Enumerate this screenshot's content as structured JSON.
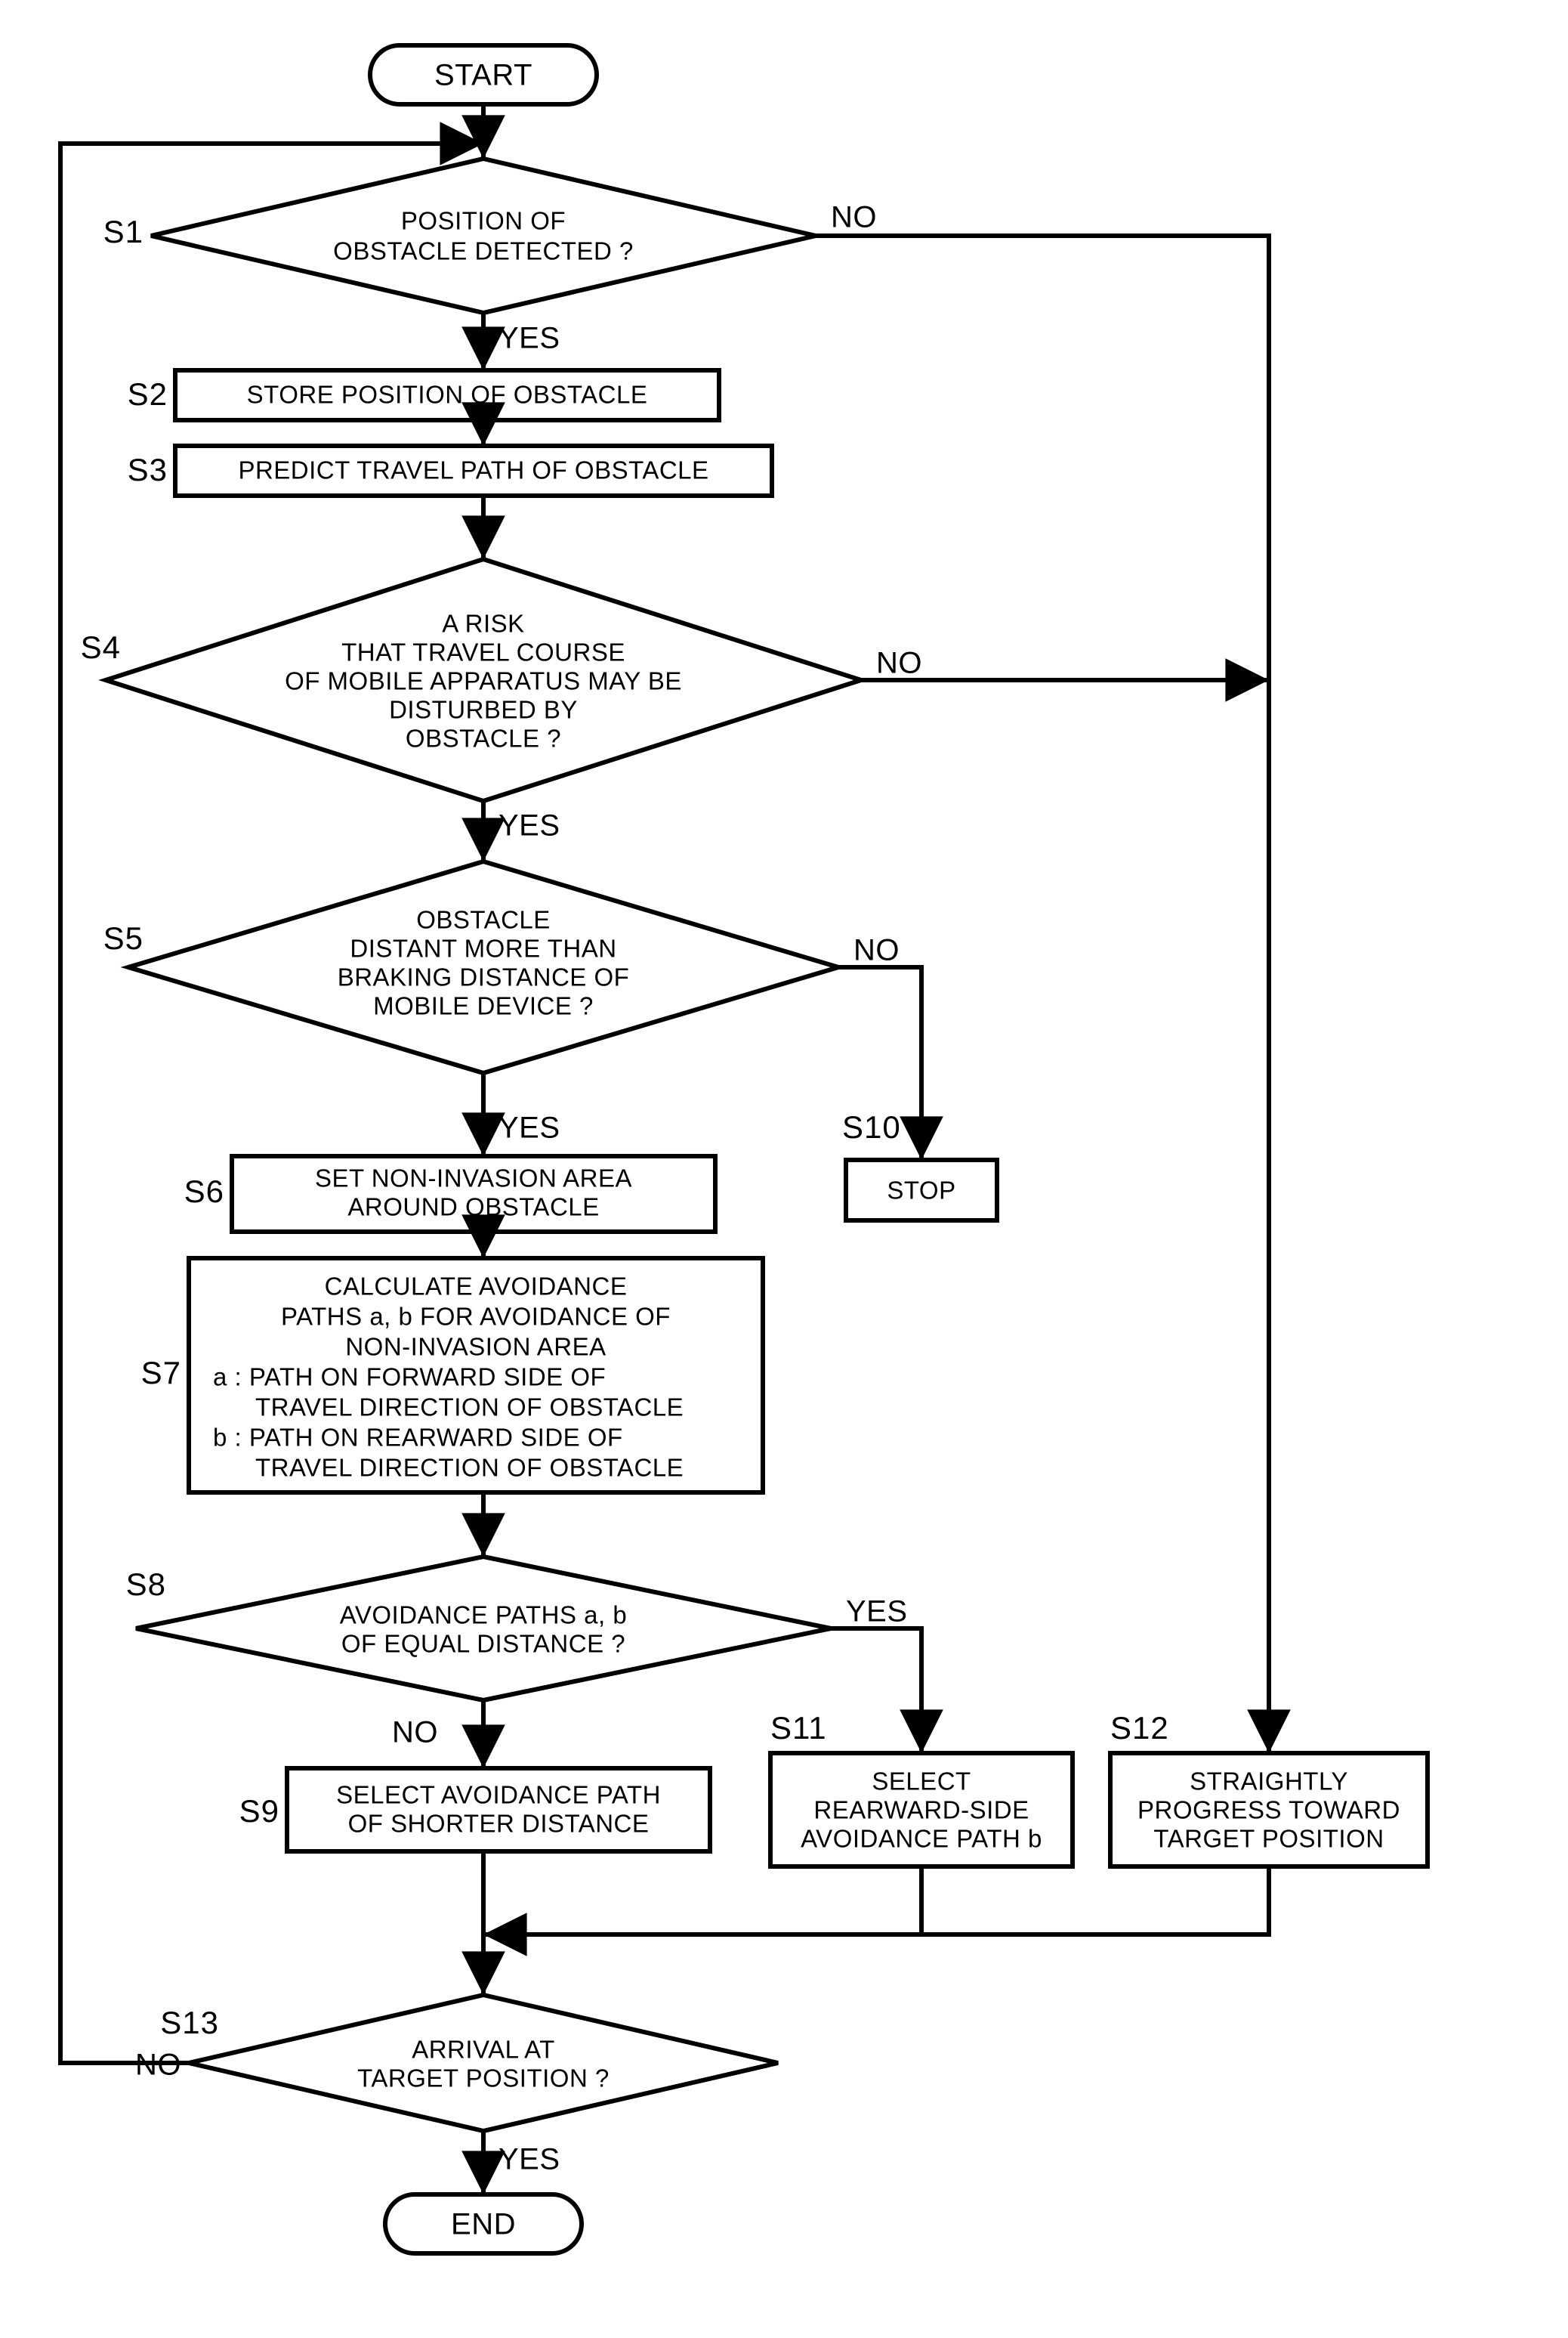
{
  "chart_data": {
    "type": "flowchart",
    "title": "",
    "nodes": [
      {
        "id": "start",
        "shape": "terminator",
        "label": "START"
      },
      {
        "id": "s1",
        "shape": "decision",
        "step": "S1",
        "label": "POSITION OF\nOBSTACLE DETECTED ?",
        "yes": "s2",
        "no": "s12"
      },
      {
        "id": "s2",
        "shape": "process",
        "step": "S2",
        "label": "STORE POSITION OF OBSTACLE"
      },
      {
        "id": "s3",
        "shape": "process",
        "step": "S3",
        "label": "PREDICT TRAVEL PATH OF OBSTACLE"
      },
      {
        "id": "s4",
        "shape": "decision",
        "step": "S4",
        "label": "A RISK\nTHAT TRAVEL COURSE\nOF MOBILE APPARATUS MAY BE\nDISTURBED BY\nOBSTACLE ?",
        "yes": "s5",
        "no": "s12"
      },
      {
        "id": "s5",
        "shape": "decision",
        "step": "S5",
        "label": "OBSTACLE\nDISTANT MORE THAN\nBRAKING DISTANCE OF\nMOBILE DEVICE ?",
        "yes": "s6",
        "no": "s10"
      },
      {
        "id": "s6",
        "shape": "process",
        "step": "S6",
        "label": "SET NON-INVASION AREA\nAROUND OBSTACLE"
      },
      {
        "id": "s7",
        "shape": "process",
        "step": "S7",
        "label": "CALCULATE AVOIDANCE\nPATHS a, b FOR AVOIDANCE OF\nNON-INVASION AREA\na : PATH ON FORWARD SIDE OF\nTRAVEL DIRECTION OF OBSTACLE\nb : PATH ON REARWARD SIDE OF\nTRAVEL DIRECTION OF OBSTACLE"
      },
      {
        "id": "s8",
        "shape": "decision",
        "step": "S8",
        "label": "AVOIDANCE PATHS a, b\nOF EQUAL DISTANCE ?",
        "yes": "s11",
        "no": "s9"
      },
      {
        "id": "s9",
        "shape": "process",
        "step": "S9",
        "label": "SELECT AVOIDANCE PATH\nOF SHORTER DISTANCE"
      },
      {
        "id": "s10",
        "shape": "process",
        "step": "S10",
        "label": "STOP"
      },
      {
        "id": "s11",
        "shape": "process",
        "step": "S11",
        "label": "SELECT\nREARWARD-SIDE\nAVOIDANCE PATH b"
      },
      {
        "id": "s12",
        "shape": "process",
        "step": "S12",
        "label": "STRAIGHTLY\nPROGRESS TOWARD\nTARGET POSITION"
      },
      {
        "id": "s13",
        "shape": "decision",
        "step": "S13",
        "label": "ARRIVAL AT\nTARGET POSITION ?",
        "yes": "end",
        "no": "s1"
      },
      {
        "id": "end",
        "shape": "terminator",
        "label": "END"
      }
    ]
  },
  "labels": {
    "start": "START",
    "end": "END",
    "yes": "YES",
    "no": "NO",
    "stop": "STOP",
    "s1": "S1",
    "s2": "S2",
    "s3": "S3",
    "s4": "S4",
    "s5": "S5",
    "s6": "S6",
    "s7": "S7",
    "s8": "S8",
    "s9": "S9",
    "s10": "S10",
    "s11": "S11",
    "s12": "S12",
    "s13": "S13",
    "d1a": "POSITION OF",
    "d1b": "OBSTACLE DETECTED ?",
    "p2": "STORE POSITION OF OBSTACLE",
    "p3": "PREDICT TRAVEL PATH OF OBSTACLE",
    "d4a": "A RISK",
    "d4b": "THAT TRAVEL COURSE",
    "d4c": "OF MOBILE APPARATUS MAY BE",
    "d4d": "DISTURBED BY",
    "d4e": "OBSTACLE ?",
    "d5a": "OBSTACLE",
    "d5b": "DISTANT MORE THAN",
    "d5c": "BRAKING DISTANCE OF",
    "d5d": "MOBILE DEVICE ?",
    "p6a": "SET NON-INVASION AREA",
    "p6b": "AROUND OBSTACLE",
    "p7a": "CALCULATE AVOIDANCE",
    "p7b": "PATHS a, b FOR AVOIDANCE OF",
    "p7c": "NON-INVASION AREA",
    "p7d": "a : PATH ON FORWARD SIDE OF",
    "p7e": "TRAVEL DIRECTION OF OBSTACLE",
    "p7f": "b : PATH ON REARWARD SIDE OF",
    "p7g": "TRAVEL DIRECTION OF OBSTACLE",
    "d8a": "AVOIDANCE PATHS a, b",
    "d8b": "OF EQUAL DISTANCE ?",
    "p9a": "SELECT AVOIDANCE PATH",
    "p9b": "OF SHORTER DISTANCE",
    "p11a": "SELECT",
    "p11b": "REARWARD-SIDE",
    "p11c": "AVOIDANCE PATH b",
    "p12a": "STRAIGHTLY",
    "p12b": "PROGRESS TOWARD",
    "p12c": "TARGET POSITION",
    "d13a": "ARRIVAL AT",
    "d13b": "TARGET POSITION ?"
  }
}
